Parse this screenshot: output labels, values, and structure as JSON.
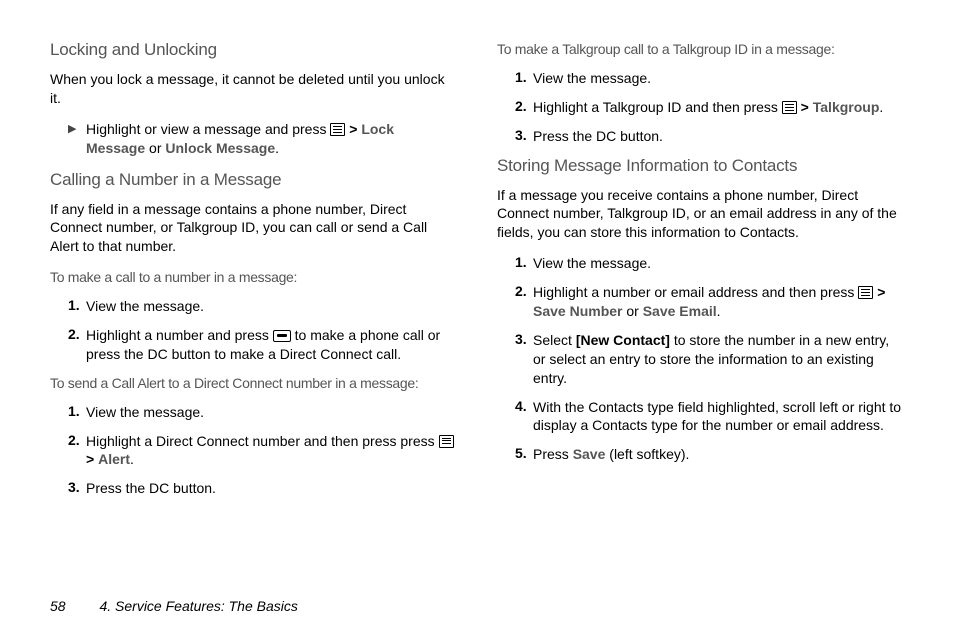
{
  "left": {
    "h1": "Locking and Unlocking",
    "p1": "When you lock a message, it cannot be deleted until you unlock it.",
    "bullet_pre": "Highlight or view a message and press ",
    "bullet_b1": "Lock Message",
    "bullet_or": " or ",
    "bullet_b2": "Unlock Message",
    "h2": "Calling a Number in a Message",
    "p2": "If any field in a message contains a phone number, Direct Connect number, or Talkgroup ID, you can call or send a Call Alert to that number.",
    "sub1": "To make a call to a number in a message:",
    "s1_1": "View the message.",
    "s1_2a": "Highlight a number and press ",
    "s1_2b": " to make a phone call or press the DC button to make a Direct Connect call.",
    "sub2": "To send a Call Alert to a Direct Connect number in a message:",
    "s2_1": "View the message.",
    "s2_2a": "Highlight a Direct Connect number and then press press ",
    "s2_2_alert": "Alert",
    "s2_3": "Press the DC button."
  },
  "right": {
    "sub0": "To make a Talkgroup call to a Talkgroup ID in a message:",
    "r0_1": "View the message.",
    "r0_2a": "Highlight a Talkgroup ID and then press ",
    "r0_2_tg": "Talkgroup",
    "r0_3": "Press the DC button.",
    "h1": "Storing Message Information to Contacts",
    "p1": "If a message you receive contains a phone number, Direct Connect number, Talkgroup ID, or an email address in any of the fields, you can store this information to Contacts.",
    "r1_1": "View the message.",
    "r1_2a": "Highlight a number or email address and then press ",
    "r1_2_sn": "Save Number",
    "r1_2_or": " or ",
    "r1_2_se": "Save Email",
    "r1_3a": "Select ",
    "r1_3_nc": "[New Contact]",
    "r1_3b": " to store the number in a new entry, or select an entry to store the information to an existing entry.",
    "r1_4": "With the Contacts type field highlighted, scroll left or right to display a Contacts type for the number or email address.",
    "r1_5a": "Press ",
    "r1_5_sv": "Save",
    "r1_5b": " (left softkey)."
  },
  "footer": {
    "page": "58",
    "chapter": "4. Service Features: The Basics"
  }
}
